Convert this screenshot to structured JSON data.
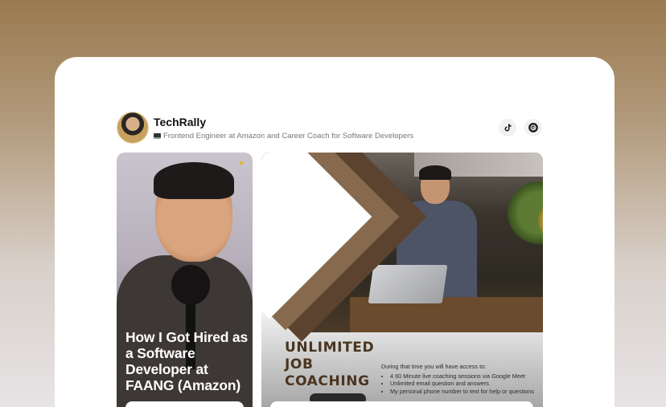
{
  "profile": {
    "name": "TechRally",
    "bio": "Frontend Engineer at Amazon and Career Coach for Software Developers",
    "bio_icon": "laptop-emoji"
  },
  "social": [
    {
      "name": "tiktok",
      "icon": "tiktok-icon"
    },
    {
      "name": "threads",
      "icon": "threads-icon"
    }
  ],
  "tiles": [
    {
      "title": "How I Got Hired as a Software Developer at FAANG (Amazon)"
    },
    {
      "heading_lines": [
        "UNLIMITED",
        "JOB",
        "COACHING"
      ],
      "access_intro": "During that time you will have access to:",
      "access_items": [
        "4 60 Minute live coaching sessions via Google Meet",
        "Unlimited email question and answers",
        "My personal phone number to text for help or questions"
      ]
    }
  ],
  "colors": {
    "accent_brown": "#5b4330",
    "background_top": "#9a7a4f"
  }
}
